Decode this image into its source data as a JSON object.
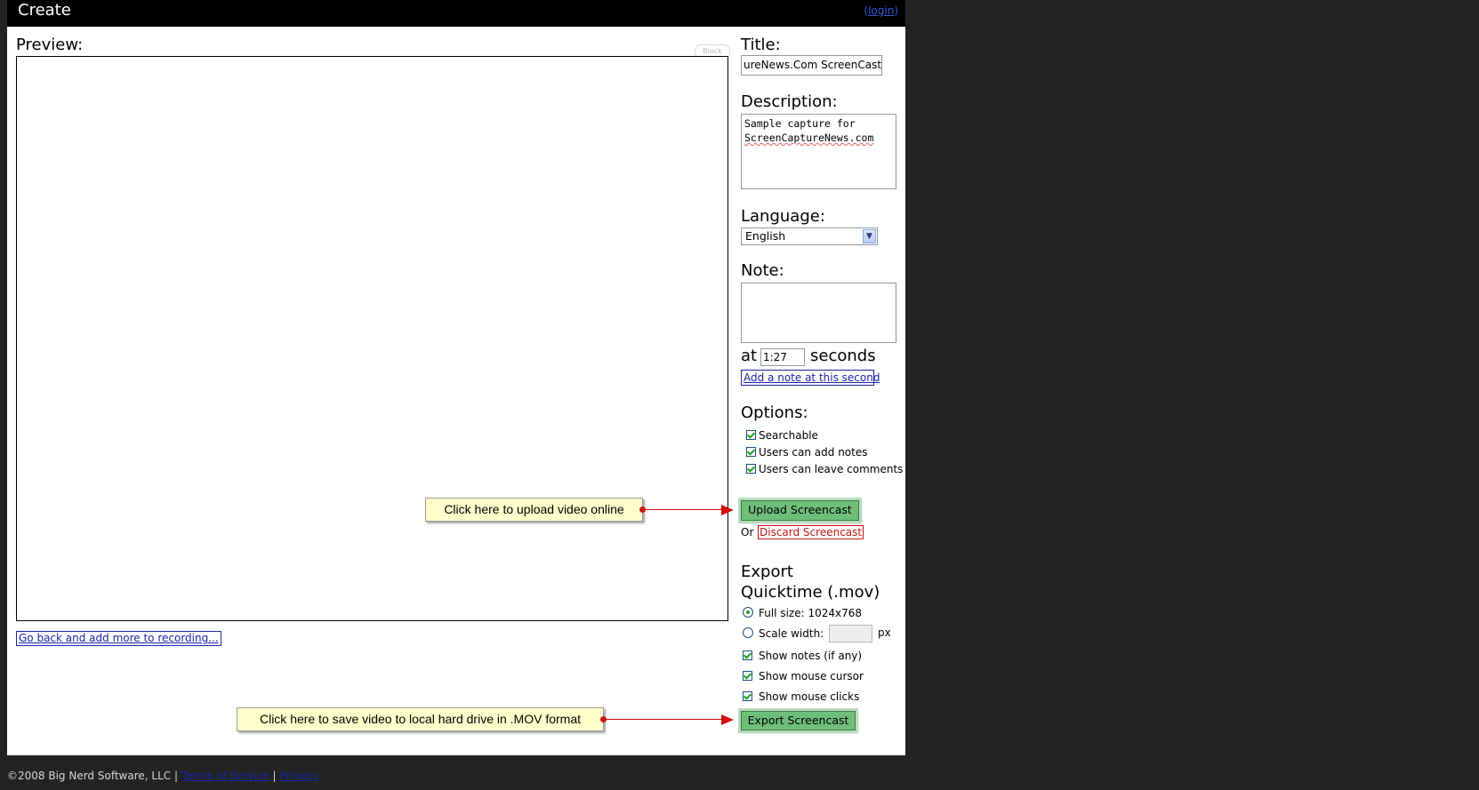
{
  "header": {
    "title": "Create",
    "login_prefix": "(",
    "login_link": "login",
    "login_suffix": ")"
  },
  "preview": {
    "label": "Preview:",
    "block_label": "Block",
    "go_back_link": "Go back and add more to recording..."
  },
  "form": {
    "title_label": "Title:",
    "title_value": "ureNews.Com ScreenCast",
    "description_label": "Description:",
    "description_line1": "Sample capture for",
    "description_line2": "ScreenCaptureNews.com",
    "language_label": "Language:",
    "language_value": "English",
    "note_label": "Note:",
    "note_value": "",
    "at_label": "at",
    "at_value": "1:27",
    "seconds_label": "seconds",
    "add_note_button": "Add a note at this second"
  },
  "options": {
    "label": "Options:",
    "items": [
      {
        "label": "Searchable",
        "checked": true
      },
      {
        "label": "Users can add notes",
        "checked": true
      },
      {
        "label": "Users can leave comments",
        "checked": true
      }
    ]
  },
  "upload": {
    "button": "Upload Screencast",
    "or_label": "Or",
    "discard_link": "Discard Screencast"
  },
  "export": {
    "heading_line1": "Export",
    "heading_line2": "Quicktime (.mov)",
    "full_size_label": "Full size: 1024x768",
    "scale_width_label": "Scale width:",
    "scale_width_value": "",
    "px_label": "px",
    "show_notes": "Show notes (if any)",
    "show_cursor": "Show mouse cursor",
    "show_clicks": "Show mouse clicks",
    "button": "Export Screencast"
  },
  "callouts": {
    "upload": "Click here to upload video online",
    "export": "Click here to save video to local hard drive in .MOV format"
  },
  "footer": {
    "copyright": "©2008 Big Nerd Software, LLC |",
    "terms_link": "Terms of Service",
    "separator": "|",
    "privacy_link": "Privacy"
  },
  "colors": {
    "accent_green": "#6fbf7a",
    "link_blue": "#1a24a8",
    "discard_red": "#c21818",
    "callout_yellow": "#ffffcc",
    "arrow_red": "#d21010"
  }
}
